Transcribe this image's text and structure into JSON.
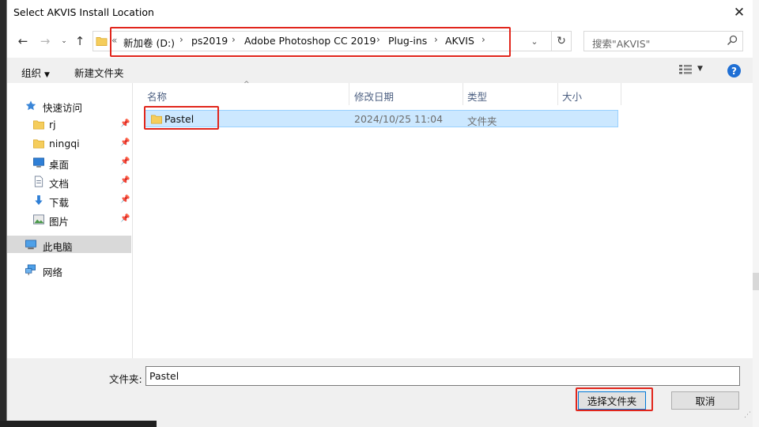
{
  "window": {
    "title": "Select AKVIS Install Location"
  },
  "nav": {
    "address_prefix": "«",
    "breadcrumbs": [
      "新加卷 (D:)",
      "ps2019",
      "Adobe Photoshop CC 2019",
      "Plug-ins",
      "AKVIS"
    ],
    "search_placeholder": "搜索\"AKVIS\""
  },
  "toolbar": {
    "organize_label": "组织",
    "new_folder_label": "新建文件夹"
  },
  "sidebar": {
    "quick_access": "快速访问",
    "pinned": [
      "rj",
      "ningqi",
      "桌面",
      "文档",
      "下载",
      "图片"
    ],
    "this_pc": "此电脑",
    "network": "网络"
  },
  "file_list": {
    "columns": [
      "名称",
      "修改日期",
      "类型",
      "大小"
    ],
    "rows": [
      {
        "name": "Pastel",
        "modified": "2024/10/25 11:04",
        "type": "文件夹",
        "size": ""
      }
    ]
  },
  "bottom": {
    "folder_label": "文件夹:",
    "folder_value": "Pastel",
    "select_button": "选择文件夹",
    "cancel_button": "取消"
  },
  "colors": {
    "selection": "#cce8ff",
    "highlight": "#e1261c",
    "accent": "#0078d7"
  },
  "icons": [
    "back-arrow-icon",
    "forward-arrow-icon",
    "recent-dropdown-icon",
    "up-arrow-icon",
    "folder-icon",
    "refresh-icon",
    "search-icon",
    "view-options-icon",
    "help-icon",
    "star-icon",
    "pin-icon",
    "desktop-icon",
    "documents-icon",
    "downloads-icon",
    "pictures-icon",
    "computer-icon",
    "network-icon"
  ]
}
